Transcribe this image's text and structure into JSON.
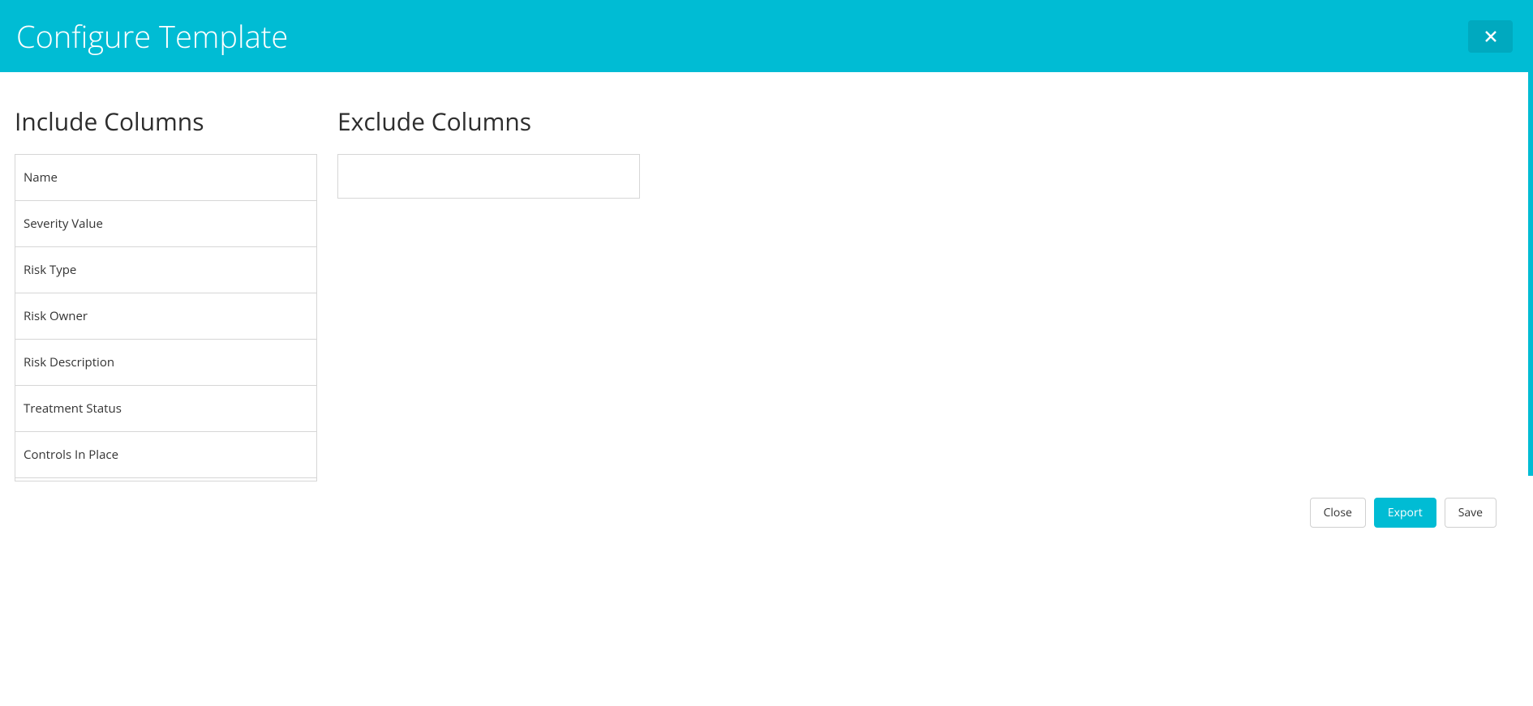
{
  "header": {
    "title": "Configure Template"
  },
  "sections": {
    "include_title": "Include Columns",
    "exclude_title": "Exclude Columns"
  },
  "include_columns": [
    "Name",
    "Severity Value",
    "Risk Type",
    "Risk Owner",
    "Risk Description",
    "Treatment Status",
    "Controls In Place"
  ],
  "exclude_columns": [],
  "footer": {
    "close_label": "Close",
    "export_label": "Export",
    "save_label": "Save"
  }
}
